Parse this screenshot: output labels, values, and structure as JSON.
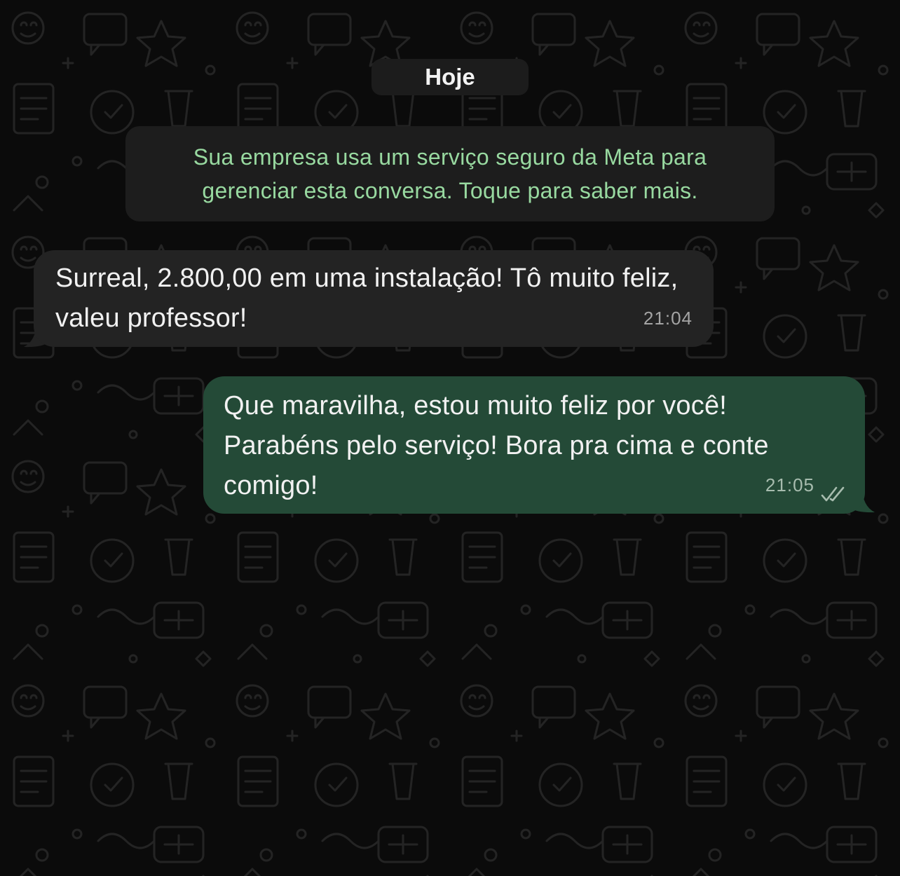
{
  "chat": {
    "date_label": "Hoje",
    "system_notice": "Sua empresa usa um serviço seguro da Meta para gerenciar esta conversa. Toque para saber mais.",
    "messages": [
      {
        "direction": "incoming",
        "text": "Surreal, 2.800,00 em uma instalação! Tô muito feliz, valeu professor!",
        "time": "21:04"
      },
      {
        "direction": "outgoing",
        "text": "Que maravilha, estou muito feliz por você! Parabéns pelo serviço! Bora pra cima e conte comigo!",
        "time": "21:05",
        "status_icon": "double-check-icon"
      }
    ]
  },
  "theme": {
    "background": "#0b0b0b",
    "incoming_bubble": "#232323",
    "outgoing_bubble": "#244a37",
    "notice_text": "#98d9a0",
    "text": "#f1f1f1",
    "timestamp": "#a4a4a4"
  }
}
